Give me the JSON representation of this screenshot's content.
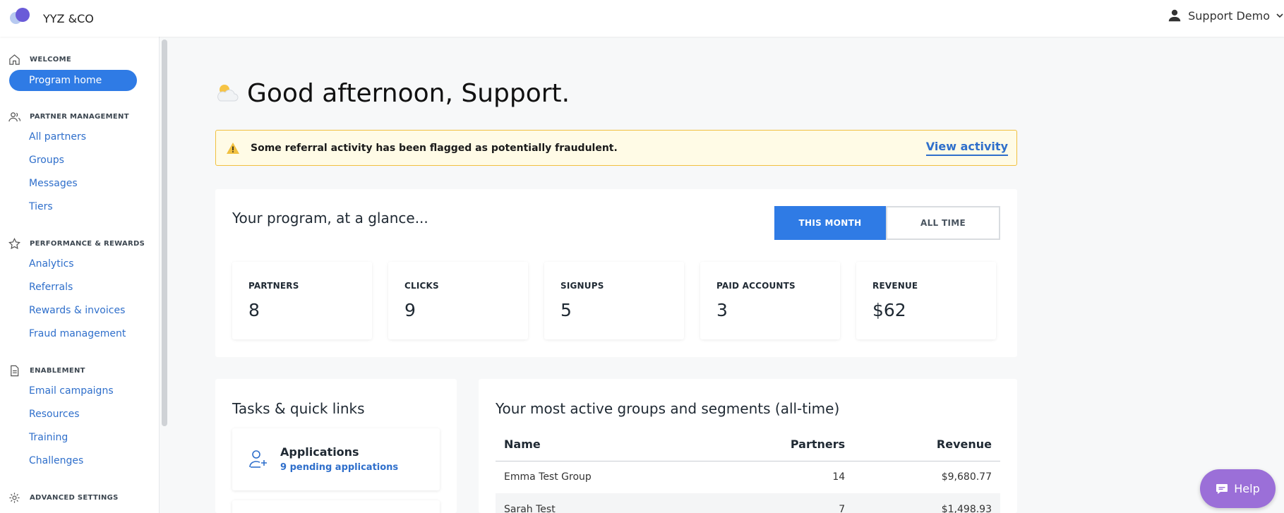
{
  "header": {
    "brand": "YYZ &CO",
    "user_name": "Support Demo"
  },
  "sidebar": {
    "sections": [
      {
        "title": "WELCOME",
        "icon": "home-icon",
        "items": [
          "Program home"
        ]
      },
      {
        "title": "PARTNER MANAGEMENT",
        "icon": "users-icon",
        "items": [
          "All partners",
          "Groups",
          "Messages",
          "Tiers"
        ]
      },
      {
        "title": "PERFORMANCE & REWARDS",
        "icon": "star-icon",
        "items": [
          "Analytics",
          "Referrals",
          "Rewards & invoices",
          "Fraud management"
        ]
      },
      {
        "title": "ENABLEMENT",
        "icon": "document-icon",
        "items": [
          "Email campaigns",
          "Resources",
          "Training",
          "Challenges"
        ]
      },
      {
        "title": "ADVANCED SETTINGS",
        "icon": "gear-icon",
        "items": []
      }
    ],
    "active_item": "Program home"
  },
  "main": {
    "greeting": "Good afternoon, Support.",
    "alert": {
      "text": "Some referral activity has been flagged as potentially fraudulent.",
      "link": "View activity"
    },
    "glance": {
      "title": "Your program, at a glance...",
      "toggle": [
        "THIS MONTH",
        "ALL TIME"
      ],
      "stats": [
        {
          "label": "PARTNERS",
          "value": "8"
        },
        {
          "label": "CLICKS",
          "value": "9"
        },
        {
          "label": "SIGNUPS",
          "value": "5"
        },
        {
          "label": "PAID ACCOUNTS",
          "value": "3"
        },
        {
          "label": "REVENUE",
          "value": "$62"
        }
      ]
    },
    "tasks": {
      "title": "Tasks & quick links",
      "items": [
        {
          "name": "Applications",
          "sub": "9 pending applications"
        }
      ]
    },
    "groups": {
      "title": "Your most active groups and segments (all-time)",
      "columns": [
        "Name",
        "Partners",
        "Revenue"
      ],
      "rows": [
        {
          "name": "Emma Test Group",
          "partners": "14",
          "revenue": "$9,680.77"
        },
        {
          "name": "Sarah Test",
          "partners": "7",
          "revenue": "$1,498.93"
        }
      ]
    }
  },
  "help": {
    "label": "Help"
  },
  "colors": {
    "accent": "#2f7be5",
    "link": "#2f6fcb",
    "alert_bg": "#fffbe6",
    "alert_border": "#f1c040",
    "help": "#9b6fd8"
  }
}
